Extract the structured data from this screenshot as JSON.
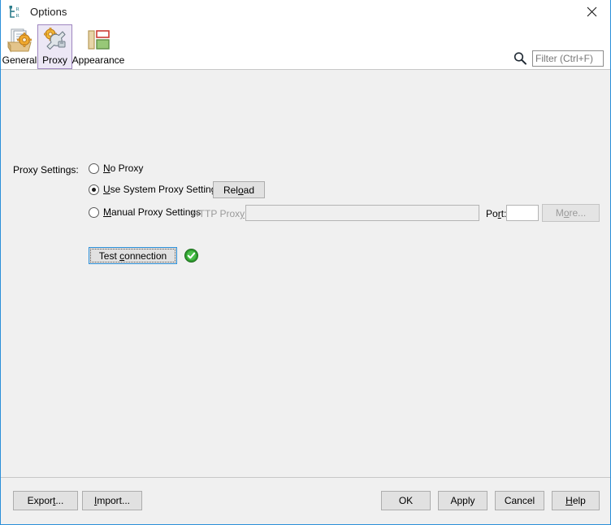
{
  "window": {
    "title": "Options",
    "title_icon": "hierarchy-tree-icon",
    "close_icon": "close-icon",
    "accent_border": "#2b8fd9",
    "content_bg": "#f0f0f0"
  },
  "toolbar": {
    "tabs": [
      {
        "label": "General",
        "icon": "documents-gear-icon",
        "selected": false
      },
      {
        "label": "Proxy",
        "icon": "gear-wrench-icon",
        "selected": true
      },
      {
        "label": "Appearance",
        "icon": "layout-blocks-icon",
        "selected": false
      }
    ],
    "selected_tab_bg": "#ece7f5",
    "selected_tab_border": "#9f86c0"
  },
  "search": {
    "icon": "search-icon",
    "placeholder": "Filter (Ctrl+F)",
    "value": ""
  },
  "main": {
    "section_label": "Proxy Settings:",
    "options": [
      {
        "id": "no-proxy",
        "label_pre": "",
        "label_mnemonic": "N",
        "label_post": "o Proxy",
        "checked": false
      },
      {
        "id": "use-system-proxy-settings",
        "label_pre": "",
        "label_mnemonic": "U",
        "label_post": "se System Proxy Settings",
        "checked": true
      },
      {
        "id": "manual-proxy-settings",
        "label_pre": "",
        "label_mnemonic": "M",
        "label_post": "anual Proxy Settings",
        "checked": false
      }
    ],
    "reload_button": {
      "pre": "Rel",
      "mnemonic": "o",
      "post": "ad",
      "disabled": false
    },
    "http_proxy": {
      "label_pre": "HTTP Prox",
      "label_mnemonic": "y",
      "label_post": ":",
      "value": "",
      "placeholder": "",
      "disabled": true
    },
    "port": {
      "label_pre": "Po",
      "label_mnemonic": "r",
      "label_post": "t:",
      "value": "",
      "placeholder": "",
      "disabled": true
    },
    "more_button": {
      "pre": "M",
      "mnemonic": "o",
      "post": "re...",
      "disabled": true
    },
    "test_connection": {
      "pre": "Test ",
      "mnemonic": "c",
      "post": "onnection",
      "focused": true,
      "status_icon": "check-circle-green-icon",
      "status_color": "#2aa02a"
    }
  },
  "footer": {
    "buttons": [
      {
        "id": "export",
        "pre": "Expor",
        "mnemonic": "t",
        "post": "..."
      },
      {
        "id": "import",
        "pre": "",
        "mnemonic": "I",
        "post": "mport..."
      },
      {
        "id": "ok",
        "pre": "OK",
        "mnemonic": "",
        "post": ""
      },
      {
        "id": "apply",
        "pre": "Apply",
        "mnemonic": "",
        "post": ""
      },
      {
        "id": "cancel",
        "pre": "Cancel",
        "mnemonic": "",
        "post": ""
      },
      {
        "id": "help",
        "pre": "",
        "mnemonic": "H",
        "post": "elp"
      }
    ]
  }
}
